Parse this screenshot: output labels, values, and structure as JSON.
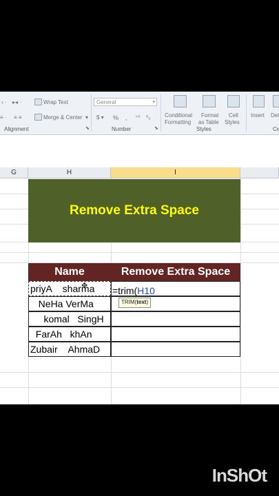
{
  "ribbon": {
    "wrap_text": "Wrap Text",
    "merge_center": "Merge & Center",
    "number_format": "General",
    "percent_symbol": "%",
    "comma_symbol": ",",
    "conditional_formatting": [
      "Conditional",
      "Formatting"
    ],
    "format_as_table": [
      "Format",
      "as Table"
    ],
    "cell_styles": [
      "Cell",
      "Styles"
    ],
    "insert": "Insert",
    "delete": "Del",
    "groups": {
      "alignment": "Alignment",
      "number": "Number",
      "styles": "Styles",
      "cells": "Ce"
    }
  },
  "sheet": {
    "columns": [
      "G",
      "H",
      "I"
    ],
    "title": "Remove Extra Space",
    "header_name": "Name",
    "header_result": "Remove Extra Space",
    "names": [
      "priyA    sharma",
      "   NeHa VerMa",
      "     komal   SingH",
      "  FarAh   khAn",
      "Zubair    AhmaD"
    ],
    "formula_prefix": "=trim(",
    "formula_ref": "H10",
    "tooltip_func": "TRIM(",
    "tooltip_arg": "text",
    "tooltip_close": ")"
  },
  "watermark": "InShOt",
  "colors": {
    "title_bg": "#4f6128",
    "title_text": "#ffff00",
    "header_bg": "#632523",
    "selected_col": "#f9dd8d"
  }
}
